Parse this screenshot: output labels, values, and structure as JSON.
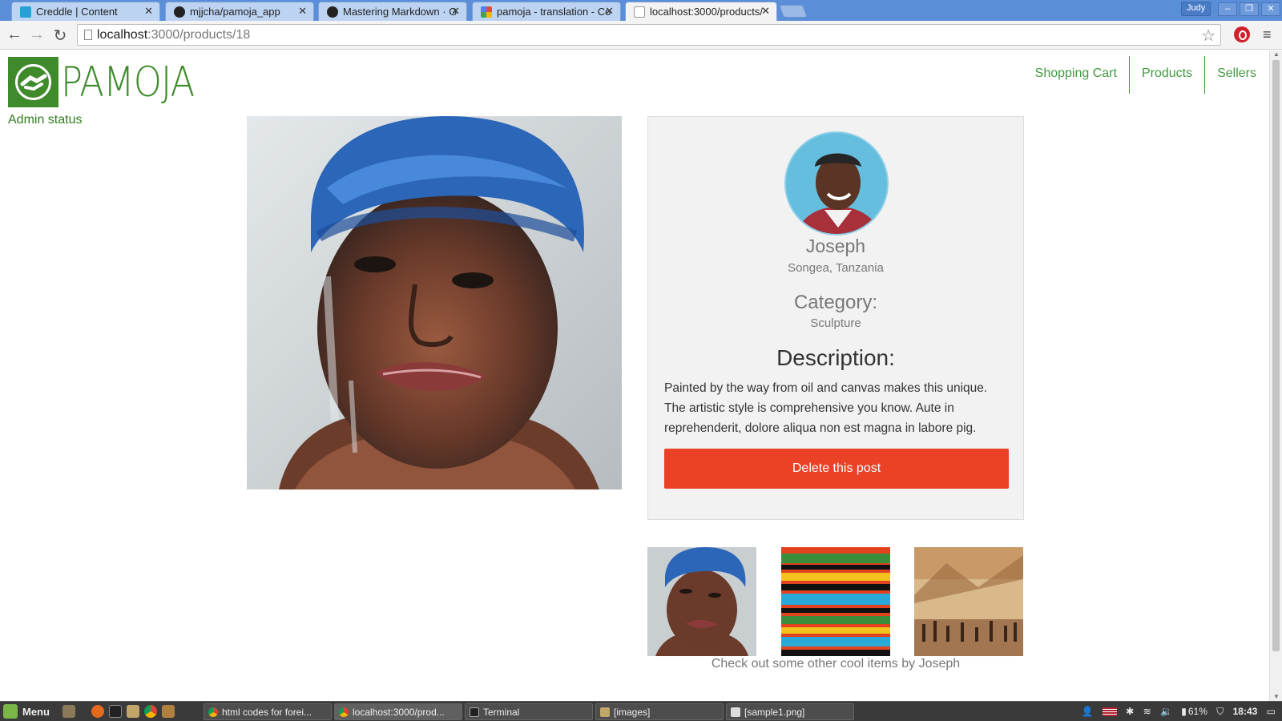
{
  "browser": {
    "tabs": [
      {
        "title": "Creddle | Content",
        "favicon_color": "#2a9fd6"
      },
      {
        "title": "mjjcha/pamoja_app",
        "favicon_color": "#222222"
      },
      {
        "title": "Mastering Markdown · G",
        "favicon_color": "#222222"
      },
      {
        "title": "pamoja - translation - Co",
        "favicon_color": "#e24c3a"
      },
      {
        "title": "localhost:3000/products/",
        "favicon_color": "#9e9e9e"
      }
    ],
    "user": "Judy",
    "url_host": "localhost",
    "url_path": ":3000/products/18"
  },
  "site": {
    "logo_text": "PAMOJA",
    "admin_status": "Admin status",
    "nav": [
      "Shopping Cart",
      "Products",
      "Sellers"
    ],
    "brand_color": "#3f8b2c"
  },
  "seller": {
    "name": "Joseph",
    "location": "Songea, Tanzania",
    "category_label": "Category:",
    "category_value": "Sculpture",
    "description_label": "Description:",
    "description": "Painted by the way from oil and canvas makes this unique. The artistic style is comprehensive you know. Aute in reprehenderit, dolore aliqua non est magna in labore pig.",
    "delete_label": "Delete this post",
    "delete_color": "#ea4127"
  },
  "more": {
    "caption": "Check out some other cool items by Joseph"
  },
  "taskbar": {
    "menu_label": "Menu",
    "tasks": [
      {
        "label": "html codes for forei..."
      },
      {
        "label": "localhost:3000/prod..."
      },
      {
        "label": "Terminal"
      },
      {
        "label": "[images]"
      },
      {
        "label": "[sample1.png]"
      }
    ],
    "battery": "61%",
    "time": "18:43"
  }
}
